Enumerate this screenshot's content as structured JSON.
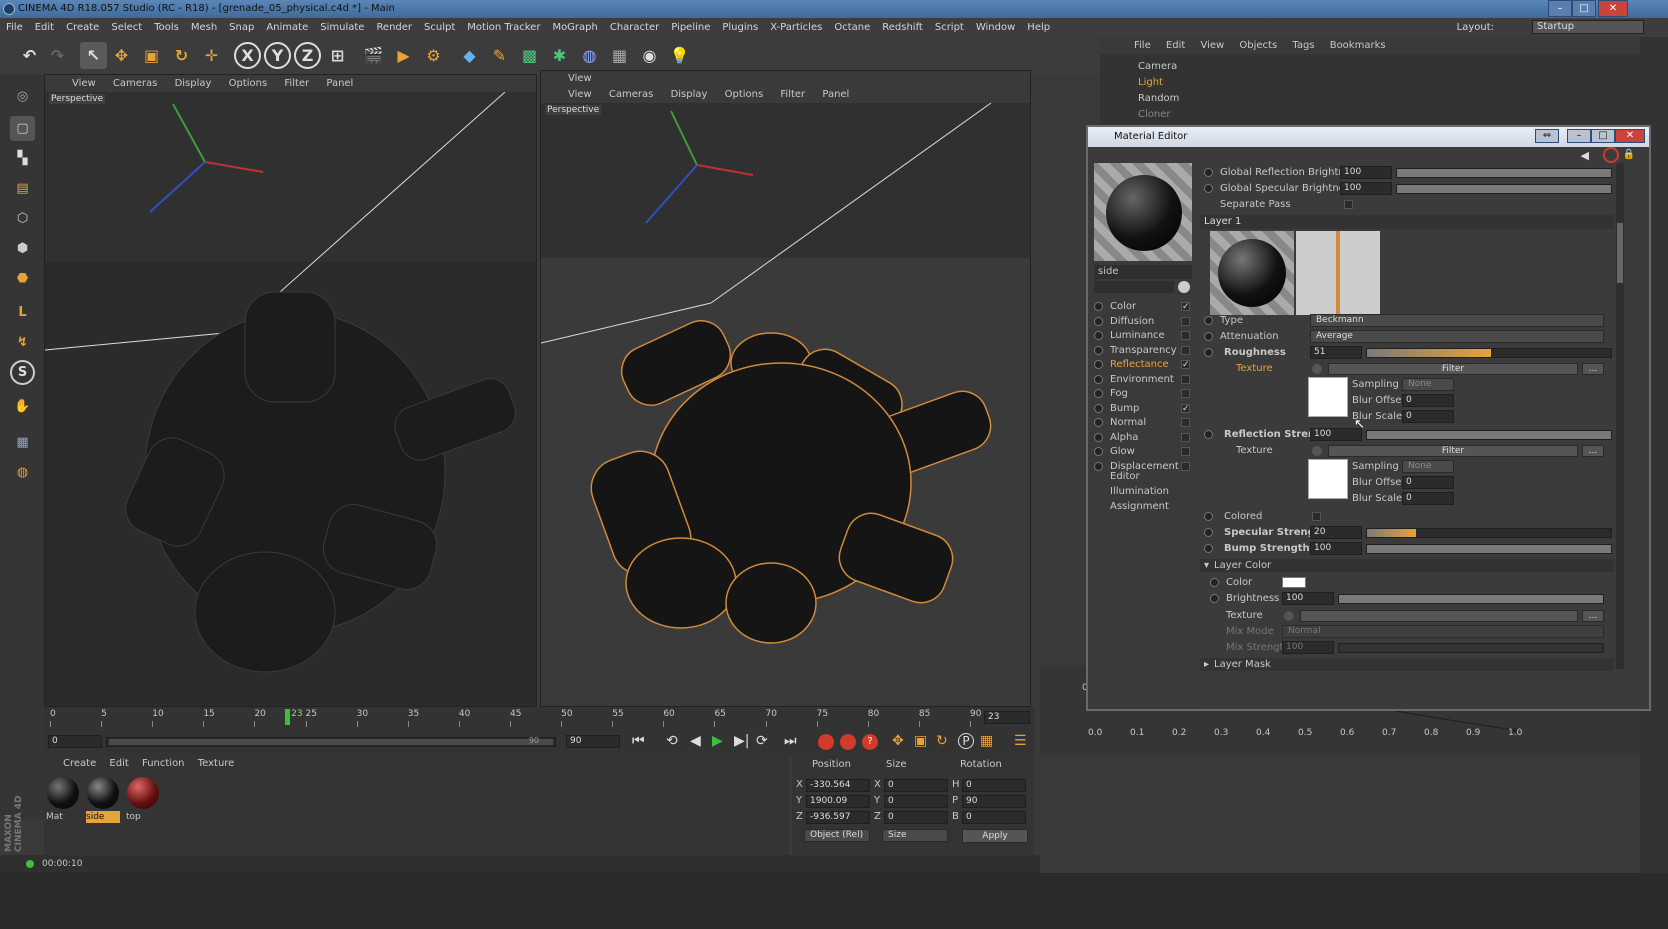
{
  "window": {
    "title": "CINEMA 4D R18.057 Studio (RC - R18) - [grenade_05_physical.c4d *] - Main",
    "controls": [
      "–",
      "□",
      "✕"
    ]
  },
  "menubar": {
    "items": [
      "File",
      "Edit",
      "Create",
      "Select",
      "Tools",
      "Mesh",
      "Snap",
      "Animate",
      "Simulate",
      "Render",
      "Sculpt",
      "Motion Tracker",
      "MoGraph",
      "Character",
      "Pipeline",
      "Plugins",
      "X-Particles",
      "Octane",
      "Redshift",
      "Script",
      "Window",
      "Help"
    ],
    "layout_label": "Layout:",
    "layout_value": "Startup"
  },
  "toolbar": {
    "icons": [
      "undo-icon",
      "redo-icon",
      "select-icon",
      "move-icon",
      "scale-icon",
      "rotate-icon",
      "live-select-icon",
      "x-axis-icon",
      "y-axis-icon",
      "z-axis-icon",
      "coord-system-icon",
      "render-view-icon",
      "render-picture-viewer-icon",
      "render-settings-icon",
      "cube-icon",
      "pen-icon",
      "subdivision-icon",
      "cloner-icon",
      "deformer-icon",
      "floor-icon",
      "camera-icon",
      "light-icon"
    ],
    "axis_labels": [
      "X",
      "Y",
      "Z"
    ]
  },
  "viewport_left": {
    "menu": [
      "View",
      "Cameras",
      "Display",
      "Options",
      "Filter",
      "Panel"
    ],
    "label": "Perspective"
  },
  "viewport_right": {
    "header": "View",
    "menu": [
      "View",
      "Cameras",
      "Display",
      "Options",
      "Filter",
      "Panel"
    ],
    "label": "Perspective"
  },
  "object_manager": {
    "menu": [
      "File",
      "Edit",
      "View",
      "Objects",
      "Tags",
      "Bookmarks"
    ],
    "objects": [
      {
        "name": "Camera",
        "color": "#c8c8c8"
      },
      {
        "name": "Light",
        "color": "#e0a64a"
      },
      {
        "name": "Random",
        "color": "#c8c8c8"
      },
      {
        "name": "Cloner",
        "color": "#888888"
      }
    ]
  },
  "material_editor": {
    "title": "Material Editor",
    "material_name": "side",
    "channels": [
      {
        "label": "Color",
        "checked": "✓"
      },
      {
        "label": "Diffusion",
        "checked": ""
      },
      {
        "label": "Luminance",
        "checked": ""
      },
      {
        "label": "Transparency",
        "checked": ""
      },
      {
        "label": "Reflectance",
        "checked": "✓",
        "active": true
      },
      {
        "label": "Environment",
        "checked": ""
      },
      {
        "label": "Fog",
        "checked": ""
      },
      {
        "label": "Bump",
        "checked": "✓"
      },
      {
        "label": "Normal",
        "checked": ""
      },
      {
        "label": "Alpha",
        "checked": ""
      },
      {
        "label": "Glow",
        "checked": ""
      },
      {
        "label": "Displacement",
        "checked": ""
      }
    ],
    "sections": [
      "Editor",
      "Illumination",
      "Assignment"
    ],
    "global_reflection": {
      "label": "Global Reflection Brightness",
      "value": "100"
    },
    "global_specular": {
      "label": "Global Specular Brightness",
      "value": "100"
    },
    "separate_pass": {
      "label": "Separate Pass"
    },
    "layer_title": "Layer 1",
    "type": {
      "label": "Type",
      "value": "Beckmann"
    },
    "attenuation": {
      "label": "Attenuation",
      "value": "Average"
    },
    "roughness": {
      "label": "Roughness",
      "value": "51",
      "fraction": 0.51
    },
    "texture1": {
      "label": "Texture",
      "button": "Filter",
      "more": "..."
    },
    "sampling1": {
      "label": "Sampling",
      "value": "None"
    },
    "blur_offset1": {
      "label": "Blur Offset",
      "value": "0"
    },
    "blur_scale1": {
      "label": "Blur Scale",
      "value": "0"
    },
    "reflection_strength": {
      "label": "Reflection Strength",
      "value": "100",
      "fraction": 1.0
    },
    "texture2": {
      "label": "Texture",
      "button": "Filter",
      "more": "..."
    },
    "sampling2": {
      "label": "Sampling",
      "value": "None"
    },
    "blur_offset2": {
      "label": "Blur Offset",
      "value": "0"
    },
    "blur_scale2": {
      "label": "Blur Scale",
      "value": "0"
    },
    "colored": {
      "label": "Colored"
    },
    "specular_strength": {
      "label": "Specular Strength",
      "value": "20",
      "fraction": 0.2
    },
    "bump_strength": {
      "label": "Bump Strength",
      "value": "100",
      "fraction": 1.0
    },
    "layer_color": {
      "title": "Layer Color",
      "color_label": "Color",
      "color_value": "#ffffff",
      "brightness_label": "Brightness",
      "brightness_value": "100",
      "texture_label": "Texture",
      "more": "...",
      "mix_mode_label": "Mix Mode",
      "mix_mode_value": "Normal",
      "mix_strength_label": "Mix Strength",
      "mix_strength_value": "100"
    },
    "layer_mask": "Layer Mask"
  },
  "timeline": {
    "ticks": [
      "0",
      "5",
      "10",
      "15",
      "20",
      "25",
      "30",
      "35",
      "40",
      "45",
      "50",
      "55",
      "60",
      "65",
      "70",
      "75",
      "80",
      "85",
      "90"
    ],
    "current_frame": "23",
    "current_frame_field": "23",
    "start_field": "0",
    "end_field": "90",
    "end_field_b": "90",
    "current_fraction": 0.2556
  },
  "material_manager": {
    "menu": [
      "Create",
      "Edit",
      "Function",
      "Texture"
    ],
    "materials": [
      {
        "name": "Mat",
        "selected": false
      },
      {
        "name": "side",
        "selected": true
      },
      {
        "name": "top",
        "selected": false
      }
    ]
  },
  "coordinates": {
    "headers": [
      "Position",
      "Size",
      "Rotation"
    ],
    "rows": [
      {
        "axis": "X",
        "pos": "-330.564",
        "size_axis": "X",
        "size": "0",
        "rot_axis": "H",
        "rot": "0"
      },
      {
        "axis": "Y",
        "pos": "1900.09",
        "size_axis": "Y",
        "size": "0",
        "rot_axis": "P",
        "rot": "90"
      },
      {
        "axis": "Z",
        "pos": "-936.597",
        "size_axis": "Z",
        "size": "0",
        "rot_axis": "B",
        "rot": "0"
      }
    ],
    "mode1": "Object (Rel)",
    "mode2": "Size",
    "apply": "Apply"
  },
  "graph": {
    "ylabel": "0.4",
    "xticks": [
      "0.0",
      "0.1",
      "0.2",
      "0.3",
      "0.4",
      "0.5",
      "0.6",
      "0.7",
      "0.8",
      "0.9",
      "1.0"
    ]
  },
  "status": {
    "time": "00:00:10"
  },
  "brand": "MAXON CINEMA 4D",
  "colors": {
    "accent_orange": "#e8a23a",
    "selection_blue": "#5a87b8",
    "record_red": "#d23a2a",
    "play_green": "#3cbf3c"
  }
}
